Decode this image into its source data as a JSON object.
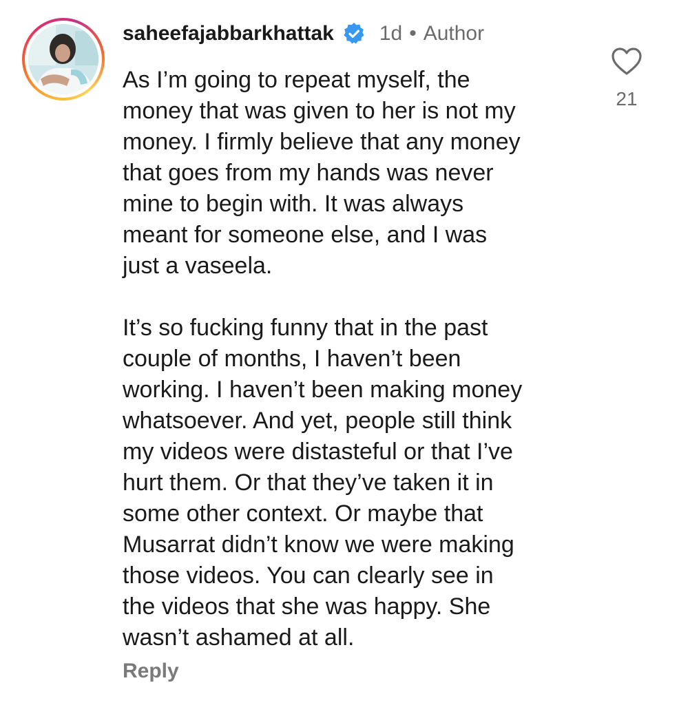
{
  "comment": {
    "username": "saheefajabbarkhattak",
    "time": "1d",
    "separator": "•",
    "badge": "Author",
    "paragraphs": [
      [
        "As I’m going to repeat myself, the",
        "money that was given to her is not my",
        "money. I firmly believe that any money",
        "that goes from my hands was never",
        "mine to begin with. It was always",
        "meant for someone else, and I was",
        "just a vaseela."
      ],
      [
        "It’s so fucking funny that in the past",
        "couple of months, I haven’t been",
        "working. I haven’t been making money",
        "whatsoever. And yet, people still think",
        "my videos were distasteful or that I’ve",
        "hurt them. Or that they’ve taken it in",
        "some other context. Or maybe that",
        "Musarrat didn’t know we were making",
        "those videos. You can clearly see in",
        "the videos that she was happy. She",
        "wasn’t ashamed at all."
      ]
    ],
    "likes": "21",
    "reply_label": "Reply"
  },
  "icons": {
    "verified": "verified-badge-icon",
    "like": "heart-outline-icon",
    "avatar": "user-avatar-photo"
  },
  "colors": {
    "verified_blue": "#3897f0",
    "muted_text": "#6b6b6b",
    "story_ring": [
      "#f9b23a",
      "#e1306c",
      "#c13584"
    ]
  }
}
